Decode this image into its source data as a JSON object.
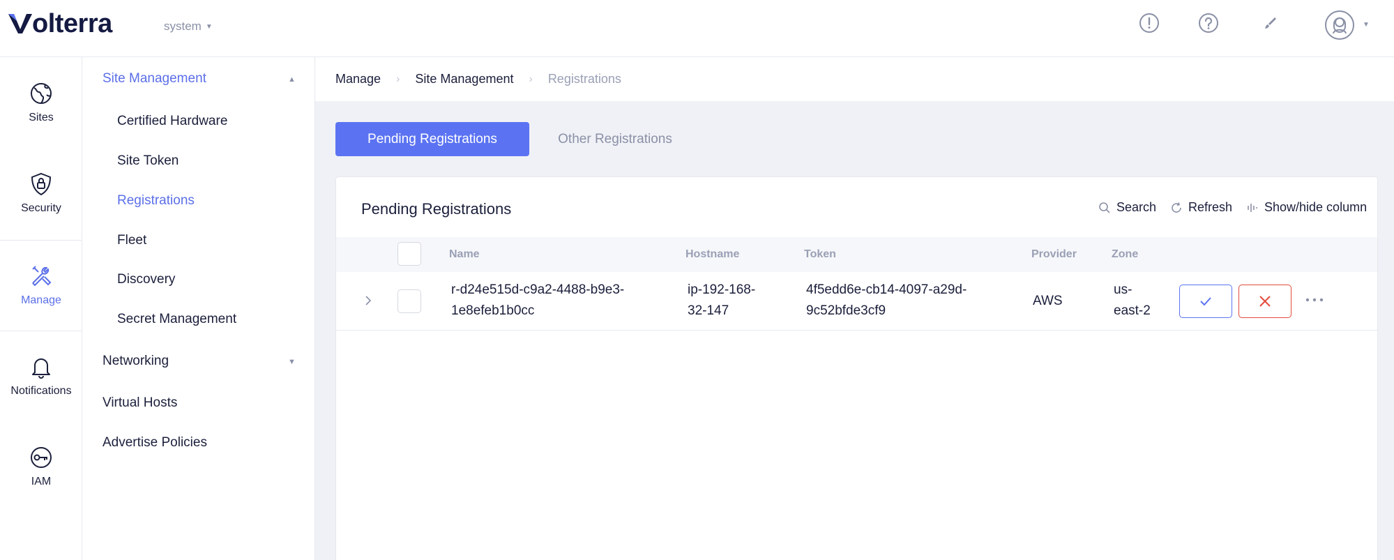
{
  "brand": {
    "name": "olterra"
  },
  "tenant": {
    "label": "system"
  },
  "top_icons": [
    "alert-icon",
    "help-icon",
    "brush-icon",
    "user-icon"
  ],
  "rail": [
    {
      "label": "Sites",
      "icon": "globe-icon"
    },
    {
      "label": "Security",
      "icon": "shield-lock-icon"
    },
    {
      "label": "Manage",
      "icon": "tools-icon",
      "active": true
    },
    {
      "label": "Notifications",
      "icon": "bell-icon"
    },
    {
      "label": "IAM",
      "icon": "key-icon"
    }
  ],
  "subnav": {
    "site_management": "Site Management",
    "certified_hardware": "Certified Hardware",
    "site_token": "Site Token",
    "registrations": "Registrations",
    "fleet": "Fleet",
    "discovery": "Discovery",
    "secret_management": "Secret Management",
    "networking": "Networking",
    "virtual_hosts": "Virtual Hosts",
    "advertise_policies": "Advertise Policies"
  },
  "breadcrumb": [
    "Manage",
    "Site Management",
    "Registrations"
  ],
  "tabs": {
    "pending": "Pending Registrations",
    "other": "Other Registrations"
  },
  "card": {
    "title": "Pending Registrations",
    "tools": {
      "search": "Search",
      "refresh": "Refresh",
      "columns": "Show/hide column"
    }
  },
  "table": {
    "columns": [
      "Name",
      "Hostname",
      "Token",
      "Provider",
      "Zone"
    ],
    "rows": [
      {
        "name_line1": "r-d24e515d-c9a2-4488-b9e3-",
        "name_line2": "1e8efeb1b0cc",
        "hostname_line1": "ip-192-168-",
        "hostname_line2": "32-147",
        "token_line1": "4f5edd6e-cb14-4097-a29d-",
        "token_line2": "9c52bfde3cf9",
        "provider": "AWS",
        "zone_line1": "us-",
        "zone_line2": "east-2"
      }
    ]
  },
  "colors": {
    "accent": "#5b73f2",
    "danger": "#e34a3b",
    "text": "#1b1f3b",
    "muted": "#9aa0b5"
  }
}
